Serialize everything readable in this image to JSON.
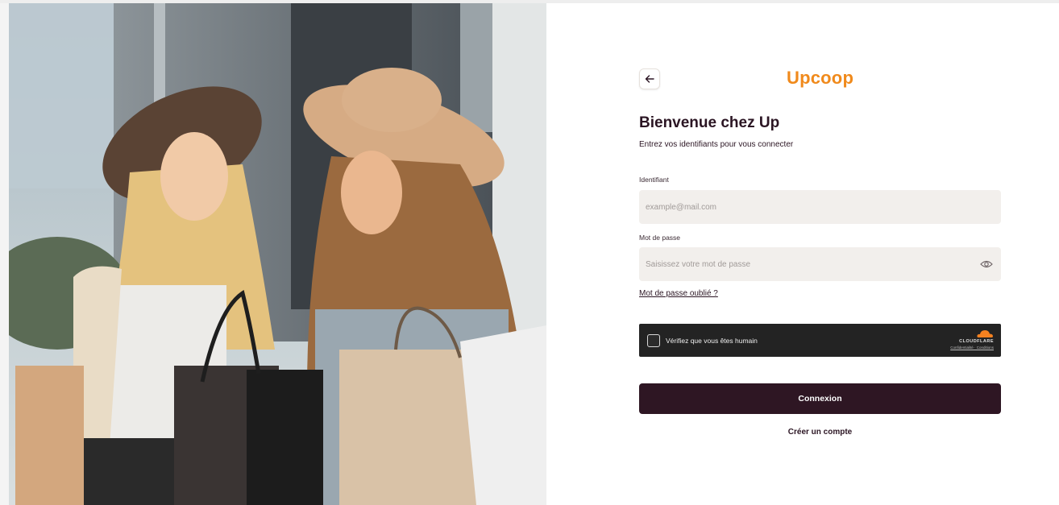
{
  "brand": {
    "logo_text": "Upcoop",
    "accent": "#f08a1c",
    "primary": "#2e1623"
  },
  "header": {
    "back_icon": "arrow-left-icon"
  },
  "form": {
    "title": "Bienvenue chez Up",
    "subtitle": "Entrez vos identifiants pour vous connecter",
    "identifier_label": "Identifiant",
    "identifier_placeholder": "example@mail.com",
    "identifier_value": "",
    "password_label": "Mot de passe",
    "password_placeholder": "Saisissez votre mot de passe",
    "password_value": "",
    "password_toggle_icon": "eye-icon",
    "forgot_link": "Mot de passe oublié ?",
    "submit_label": "Connexion",
    "create_account_link": "Créer un compte"
  },
  "captcha": {
    "label": "Vérifiez que vous êtes humain",
    "provider": "CLOUDFLARE",
    "links": "Confidentialité · Conditions",
    "checked": false
  },
  "hero": {
    "image": "two-women-shopping-bags-photo"
  }
}
